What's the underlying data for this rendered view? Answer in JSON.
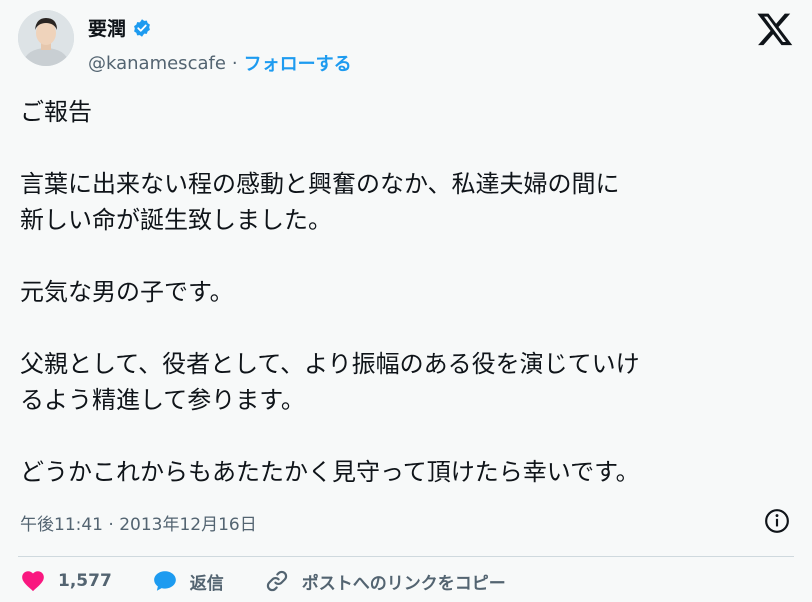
{
  "author": {
    "display_name": "要潤",
    "handle": "@kanamescafe",
    "separator": "·",
    "follow_label": "フォローする"
  },
  "tweet": {
    "lines": [
      "ご報告",
      "",
      "言葉に出来ない程の感動と興奮のなか、私達夫婦の間に",
      "新しい命が誕生致しました。",
      "",
      "元気な男の子です。",
      "",
      "父親として、役者として、より振幅のある役を演じていけ",
      "るよう精進して参ります。",
      "",
      "どうかこれからもあたたかく見守って頂けたら幸いです。"
    ],
    "timestamp": "午後11:41 · 2013年12月16日"
  },
  "actions": {
    "like_count": "1,577",
    "reply_label": "返信",
    "copy_link_label": "ポストへのリンクをコピー"
  },
  "colors": {
    "accent": "#1d9bf0",
    "like": "#f91880",
    "muted": "#536471"
  },
  "icons": [
    "verified-badge-icon",
    "x-logo-icon",
    "info-icon",
    "heart-icon",
    "reply-bubble-icon",
    "link-icon"
  ]
}
